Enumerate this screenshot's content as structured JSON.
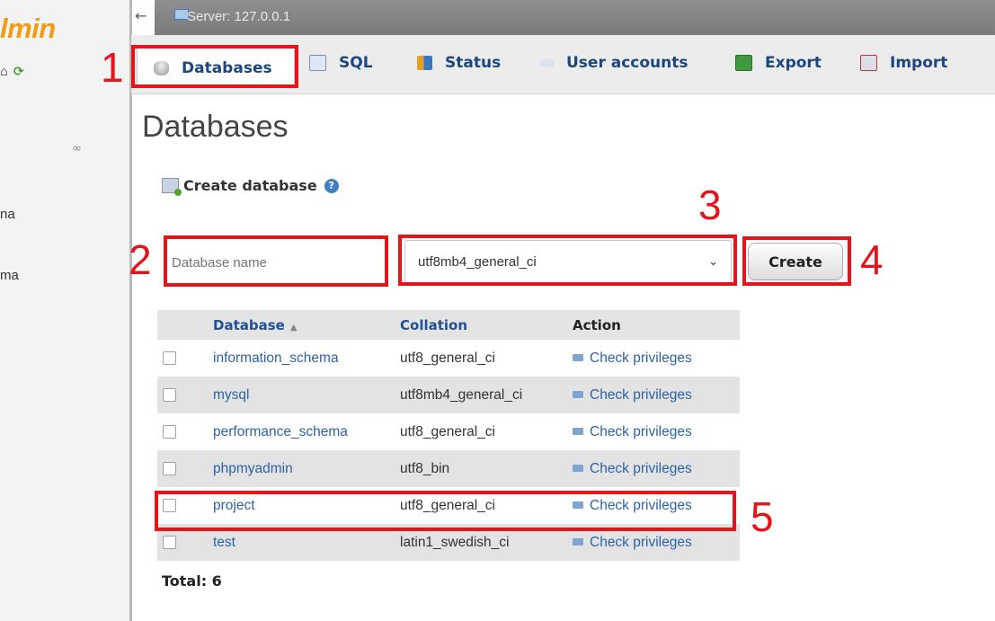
{
  "navigation": {
    "logo_text": "lmin",
    "reload_glyph": "⟳",
    "items": [
      "na",
      "ma"
    ]
  },
  "server_bar": {
    "label": "Server: 127.0.0.1"
  },
  "tabs": [
    {
      "label": "Databases",
      "icon": "database-icon",
      "active": true
    },
    {
      "label": "SQL",
      "icon": "sql-icon"
    },
    {
      "label": "Status",
      "icon": "status-icon"
    },
    {
      "label": "User accounts",
      "icon": "user-accounts-icon"
    },
    {
      "label": "Export",
      "icon": "export-icon"
    },
    {
      "label": "Import",
      "icon": "import-icon"
    }
  ],
  "page": {
    "title": "Databases",
    "create_heading": "Create database"
  },
  "create_form": {
    "name_placeholder": "Database name",
    "name_value": "",
    "collation_selected": "utf8mb4_general_ci",
    "create_label": "Create"
  },
  "table": {
    "headers": {
      "database": "Database",
      "collation": "Collation",
      "action": "Action"
    },
    "rows": [
      {
        "name": "information_schema",
        "collation": "utf8_general_ci",
        "action": "Check privileges"
      },
      {
        "name": "mysql",
        "collation": "utf8mb4_general_ci",
        "action": "Check privileges"
      },
      {
        "name": "performance_schema",
        "collation": "utf8_general_ci",
        "action": "Check privileges"
      },
      {
        "name": "phpmyadmin",
        "collation": "utf8_bin",
        "action": "Check privileges"
      },
      {
        "name": "project",
        "collation": "utf8_general_ci",
        "action": "Check privileges"
      },
      {
        "name": "test",
        "collation": "latin1_swedish_ci",
        "action": "Check privileges"
      }
    ],
    "total_label": "Total: 6"
  },
  "annotations": {
    "step1": "1",
    "step2": "2",
    "step3": "3",
    "step4": "4",
    "step5": "5"
  },
  "colors": {
    "annotation_red": "#e3151a",
    "logo_orange": "#f29b15",
    "link_blue": "#2d62a8",
    "tab_text_blue": "#1c4680"
  }
}
